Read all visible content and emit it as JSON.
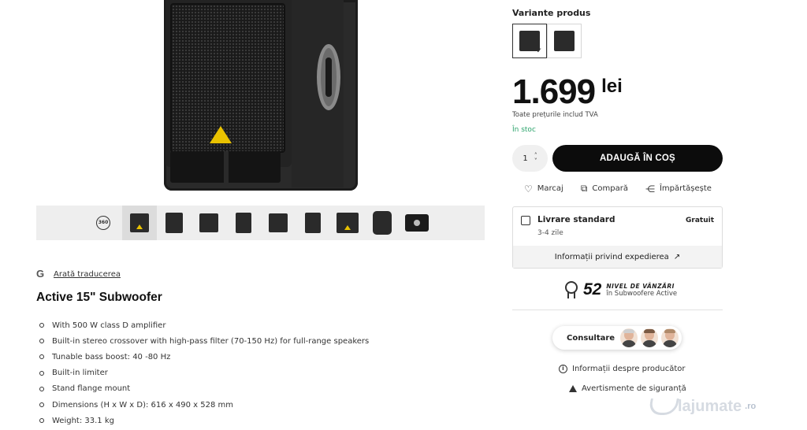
{
  "gallery": {
    "thumb_360_label": "360",
    "thumbnail_count": 9
  },
  "translate": {
    "icon": "google-g-icon",
    "link": "Arată traducerea"
  },
  "description": {
    "title": "Active 15\" Subwoofer",
    "features": [
      "With 500 W class D amplifier",
      "Built-in stereo crossover with high-pass filter (70-150 Hz) for full-range speakers",
      "Tunable bass boost: 40 -80 Hz",
      "Built-in limiter",
      "Stand flange mount",
      "Dimensions (H x W x D): 616 x 490 x 528 mm",
      "Weight: 33.1 kg"
    ]
  },
  "product": {
    "variants_label": "Variante produs",
    "variant_check": "✓",
    "price": "1.699",
    "currency": "lei",
    "vat_note": "Toate prețurile includ TVA",
    "stock": "În stoc",
    "stock_color": "#2aa36b",
    "quantity": "1",
    "add_to_cart": "ADAUGĂ ÎN COȘ"
  },
  "actions": {
    "mark": "Marcaj",
    "compare": "Compară",
    "share": "Împărtășește"
  },
  "shipping": {
    "title": "Livrare standard",
    "days": "3-4 zile",
    "price": "Gratuit",
    "info_link": "Informații privind expedierea"
  },
  "rank": {
    "number": "52",
    "line1": "NIVEL DE VÂNZĂRI",
    "line2": "în Subwoofere Active"
  },
  "consult": {
    "label": "Consultare"
  },
  "info": {
    "producer": "Informații despre producător",
    "safety": "Avertismente de siguranță"
  },
  "watermark": {
    "brand": "lajumate",
    "tld": ".ro"
  }
}
